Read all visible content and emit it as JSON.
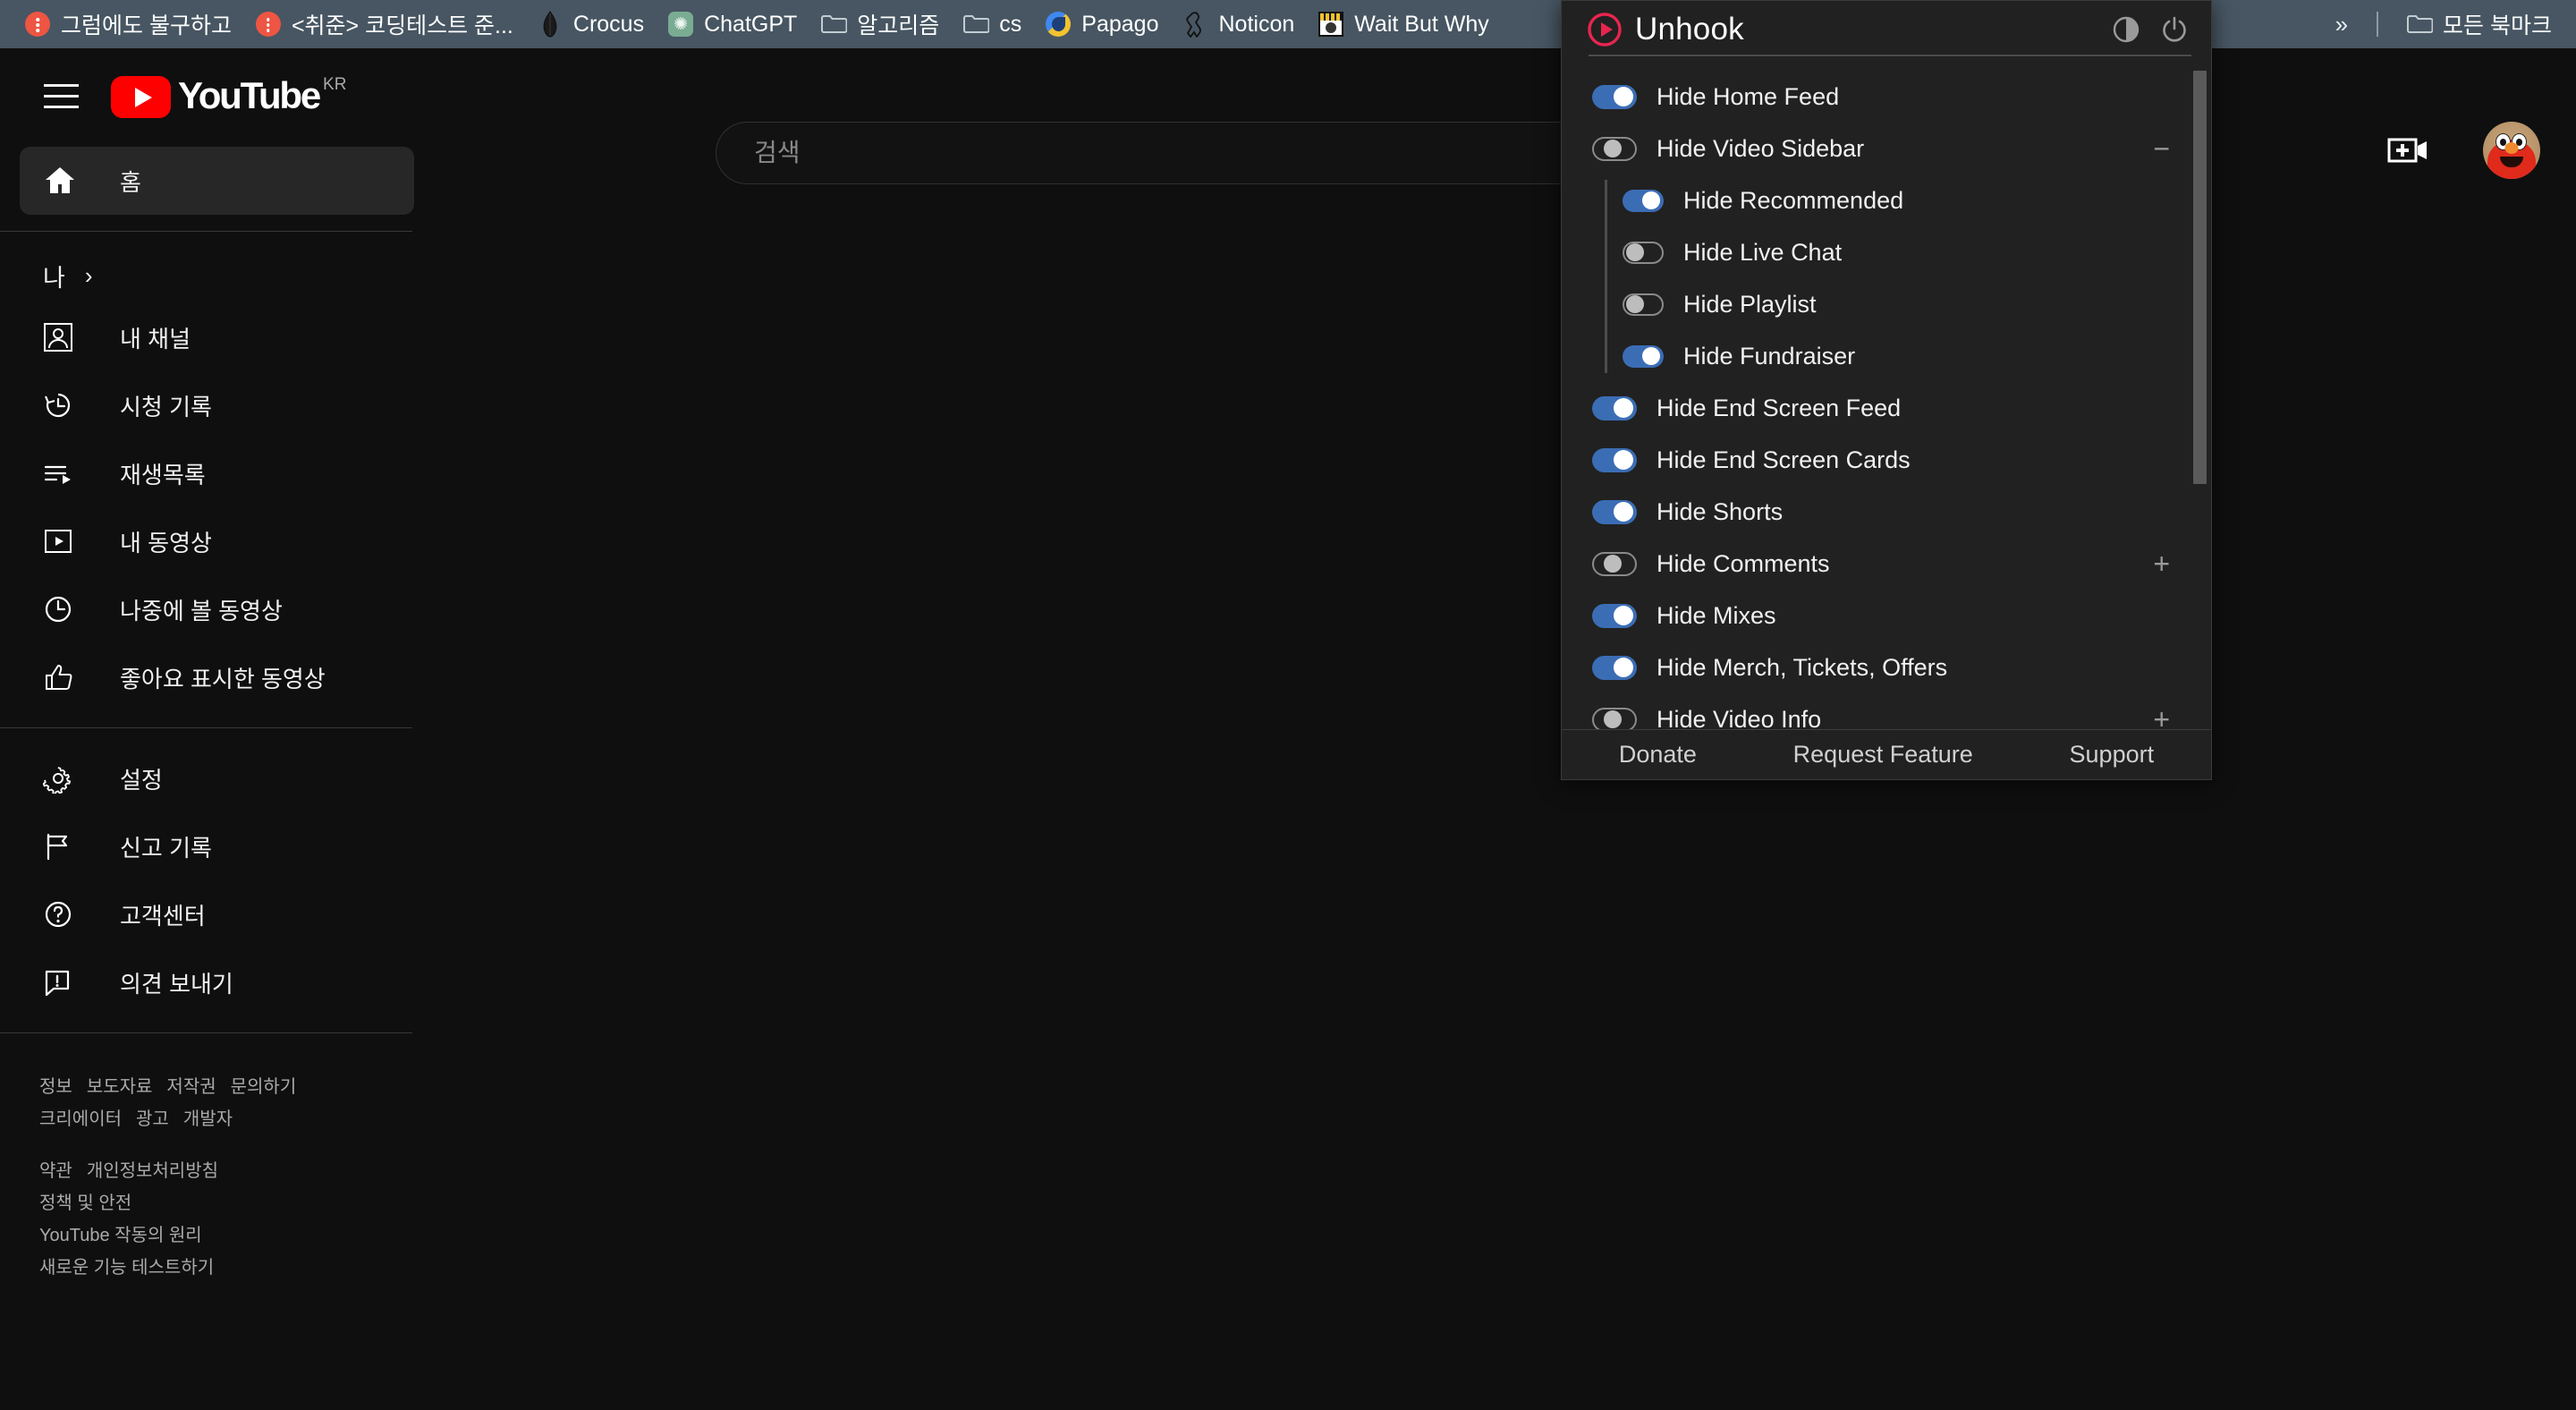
{
  "browser": {
    "bookmarks": [
      {
        "label": "그럼에도 불구하고",
        "icon": "tistory-icon"
      },
      {
        "label": "<취준> 코딩테스트 준...",
        "icon": "tistory-icon"
      },
      {
        "label": "Crocus",
        "icon": "crocus-icon"
      },
      {
        "label": "ChatGPT",
        "icon": "chatgpt-icon"
      },
      {
        "label": "알고리즘",
        "icon": "folder-icon"
      },
      {
        "label": "cs",
        "icon": "folder-icon"
      },
      {
        "label": "Papago",
        "icon": "papago-icon"
      },
      {
        "label": "Noticon",
        "icon": "noticon-icon"
      },
      {
        "label": "Wait But Why",
        "icon": "waitbutwhy-icon"
      }
    ],
    "overflow_label": "»",
    "all_bookmarks_label": "모든 북마크"
  },
  "youtube": {
    "logo_text": "YouTube",
    "logo_locale": "KR",
    "search": {
      "placeholder": "검색",
      "value": ""
    },
    "guide": {
      "home": {
        "label": "홈",
        "icon": "home-icon"
      },
      "you_section": {
        "label": "나",
        "chevron": "›"
      },
      "you_items": [
        {
          "label": "내 채널",
          "icon": "channel-icon"
        },
        {
          "label": "시청 기록",
          "icon": "history-icon"
        },
        {
          "label": "재생목록",
          "icon": "playlist-icon"
        },
        {
          "label": "내 동영상",
          "icon": "your-videos-icon"
        },
        {
          "label": "나중에 볼 동영상",
          "icon": "watch-later-icon"
        },
        {
          "label": "좋아요 표시한 동영상",
          "icon": "thumbs-up-icon"
        }
      ],
      "settings_items": [
        {
          "label": "설정",
          "icon": "gear-icon"
        },
        {
          "label": "신고 기록",
          "icon": "flag-icon"
        },
        {
          "label": "고객센터",
          "icon": "help-icon"
        },
        {
          "label": "의견 보내기",
          "icon": "feedback-icon"
        }
      ],
      "footer_groups": [
        [
          "정보",
          "보도자료",
          "저작권",
          "문의하기"
        ],
        [
          "크리에이터",
          "광고",
          "개발자"
        ],
        [
          "약관",
          "개인정보처리방침"
        ],
        [
          "정책 및 안전"
        ],
        [
          "YouTube 작동의 원리"
        ],
        [
          "새로운 기능 테스트하기"
        ]
      ]
    }
  },
  "unhook": {
    "title": "Unhook",
    "header_buttons": [
      {
        "name": "theme-toggle",
        "icon": "contrast-icon"
      },
      {
        "name": "power-toggle",
        "icon": "power-icon"
      }
    ],
    "items": [
      {
        "label": "Hide Home Feed",
        "state": "on",
        "level": 0,
        "expand": null
      },
      {
        "label": "Hide Video Sidebar",
        "state": "off",
        "level": 0,
        "expand": "−"
      },
      {
        "label": "Hide Recommended",
        "state": "on",
        "level": 1,
        "expand": null
      },
      {
        "label": "Hide Live Chat",
        "state": "off",
        "level": 1,
        "expand": null
      },
      {
        "label": "Hide Playlist",
        "state": "off",
        "level": 1,
        "expand": null
      },
      {
        "label": "Hide Fundraiser",
        "state": "on",
        "level": 1,
        "expand": null
      },
      {
        "label": "Hide End Screen Feed",
        "state": "on",
        "level": 0,
        "expand": null
      },
      {
        "label": "Hide End Screen Cards",
        "state": "on",
        "level": 0,
        "expand": null
      },
      {
        "label": "Hide Shorts",
        "state": "on",
        "level": 0,
        "expand": null
      },
      {
        "label": "Hide Comments",
        "state": "off",
        "level": 0,
        "expand": "+"
      },
      {
        "label": "Hide Mixes",
        "state": "on",
        "level": 0,
        "expand": null
      },
      {
        "label": "Hide Merch, Tickets, Offers",
        "state": "on",
        "level": 0,
        "expand": null
      },
      {
        "label": "Hide Video Info",
        "state": "off",
        "level": 0,
        "expand": "+"
      }
    ],
    "footer_links": [
      "Donate",
      "Request Feature",
      "Support"
    ],
    "colors": {
      "toggle_on": "#3b6db5",
      "toggle_off_border": "#8a8a8a",
      "logo_red": "#e8254f",
      "panel_bg": "#212121"
    }
  }
}
